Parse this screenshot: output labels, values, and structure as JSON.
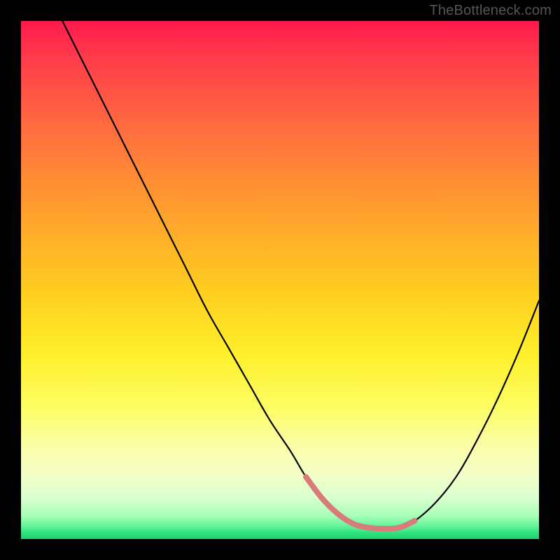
{
  "watermark": "TheBottleneck.com",
  "chart_data": {
    "type": "line",
    "title": "",
    "xlabel": "",
    "ylabel": "",
    "xlim": [
      0,
      100
    ],
    "ylim": [
      0,
      100
    ],
    "grid": false,
    "legend": false,
    "gradient_stops": [
      {
        "pct": 0,
        "color": "#ff1a4d"
      },
      {
        "pct": 20,
        "color": "#ff6a3f"
      },
      {
        "pct": 52,
        "color": "#ffcd20"
      },
      {
        "pct": 82,
        "color": "#fcfda8"
      },
      {
        "pct": 96,
        "color": "#80f5a4"
      },
      {
        "pct": 100,
        "color": "#1fd46e"
      }
    ],
    "series": [
      {
        "name": "bottleneck-curve",
        "color": "#000000",
        "x": [
          8,
          12,
          16,
          20,
          24,
          28,
          32,
          36,
          40,
          44,
          48,
          52,
          55,
          58,
          61,
          64,
          67,
          70,
          73,
          76,
          80,
          84,
          88,
          92,
          96,
          100
        ],
        "y": [
          100,
          92,
          84,
          76,
          68,
          60,
          52,
          44,
          37,
          30,
          23,
          17,
          12,
          8,
          5,
          3,
          2.2,
          2,
          2.2,
          3.5,
          7,
          12,
          19,
          27,
          36,
          46
        ]
      },
      {
        "name": "highlight-flat-region",
        "color": "#d97b7b",
        "stroke_width": 8,
        "x": [
          55,
          58,
          61,
          64,
          67,
          70,
          73,
          76
        ],
        "y": [
          12,
          8,
          5,
          3,
          2.2,
          2,
          2.2,
          3.5
        ]
      }
    ],
    "annotations": []
  }
}
